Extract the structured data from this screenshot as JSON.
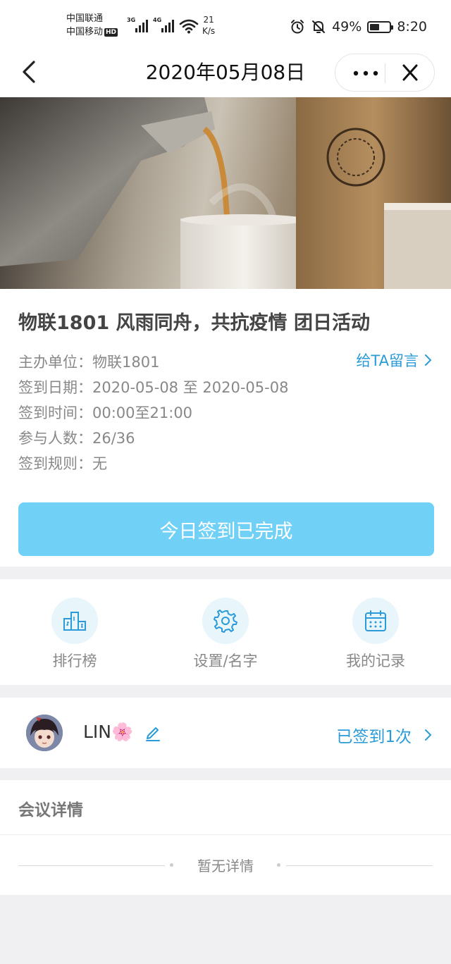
{
  "status_bar": {
    "carrier1": "中国联通",
    "carrier2": "中国移动",
    "hd": "HD",
    "net1": "3G",
    "net2": "4G",
    "speed_value": "21",
    "speed_unit": "K/s",
    "battery": "49%",
    "battery_level": 0.49,
    "time": "8:20"
  },
  "nav": {
    "title": "2020年05月08日"
  },
  "event": {
    "title": "物联1801 风雨同舟，共抗疫情 团日活动",
    "organizer_label": "主办单位：",
    "organizer_value": "物联1801",
    "date_label": "签到日期：",
    "date_value": "2020-05-08 至 2020-05-08",
    "time_label": "签到时间：",
    "time_value": "00:00至21:00",
    "people_label": "参与人数：",
    "people_value": "26/36",
    "rule_label": "签到规则：",
    "rule_value": "无",
    "message_link": "给TA留言",
    "checkin_button": "今日签到已完成"
  },
  "quick_actions": [
    {
      "label": "排行榜",
      "icon": "podium-icon"
    },
    {
      "label": "设置/名字",
      "icon": "gear-icon"
    },
    {
      "label": "我的记录",
      "icon": "calendar-icon"
    }
  ],
  "user": {
    "name": "LIN🌸",
    "signed_text": "已签到1次"
  },
  "details": {
    "title": "会议详情",
    "empty": "暂无详情"
  },
  "colors": {
    "accent": "#2a9bd8",
    "button": "#70d0f5",
    "icon_bg": "#e8f6fc"
  }
}
